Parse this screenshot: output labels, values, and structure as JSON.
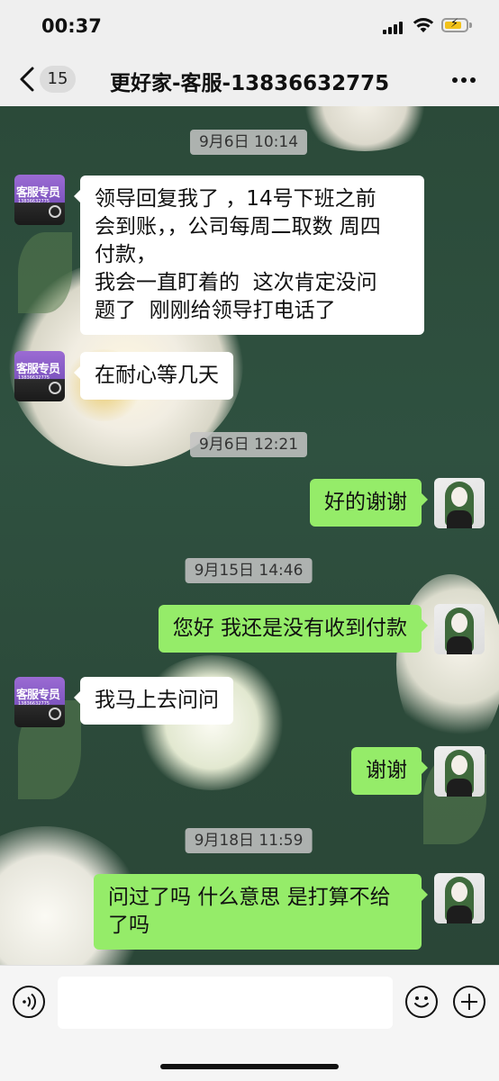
{
  "status_bar": {
    "time": "00:37"
  },
  "header": {
    "back_badge": "15",
    "title": "更好家-客服-13836632775"
  },
  "avatars": {
    "customer_service_label": "客服专员",
    "customer_service_sub": "13836632775"
  },
  "messages": [
    {
      "type": "timestamp",
      "text": "9月6日 10:14"
    },
    {
      "type": "incoming",
      "text": "领导回复我了 ，14号下班之前\n会到账，，公司每周二取数 周四\n付款，\n我会一直盯着的  这次肯定没问\n题了  刚刚给领导打电话了"
    },
    {
      "type": "incoming",
      "text": "在耐心等几天"
    },
    {
      "type": "timestamp",
      "text": "9月6日 12:21"
    },
    {
      "type": "outgoing",
      "text": "好的谢谢"
    },
    {
      "type": "timestamp",
      "text": "9月15日 14:46"
    },
    {
      "type": "outgoing",
      "text": "您好 我还是没有收到付款"
    },
    {
      "type": "incoming",
      "text": "我马上去问问"
    },
    {
      "type": "outgoing",
      "text": "谢谢"
    },
    {
      "type": "timestamp",
      "text": "9月18日 11:59"
    },
    {
      "type": "outgoing",
      "text": "问过了吗 什么意思 是打算不给\n了吗"
    }
  ],
  "input_bar": {
    "placeholder": ""
  },
  "colors": {
    "outgoing_bubble": "#95ec69",
    "incoming_bubble": "#ffffff",
    "chat_background": "#2f5140"
  }
}
